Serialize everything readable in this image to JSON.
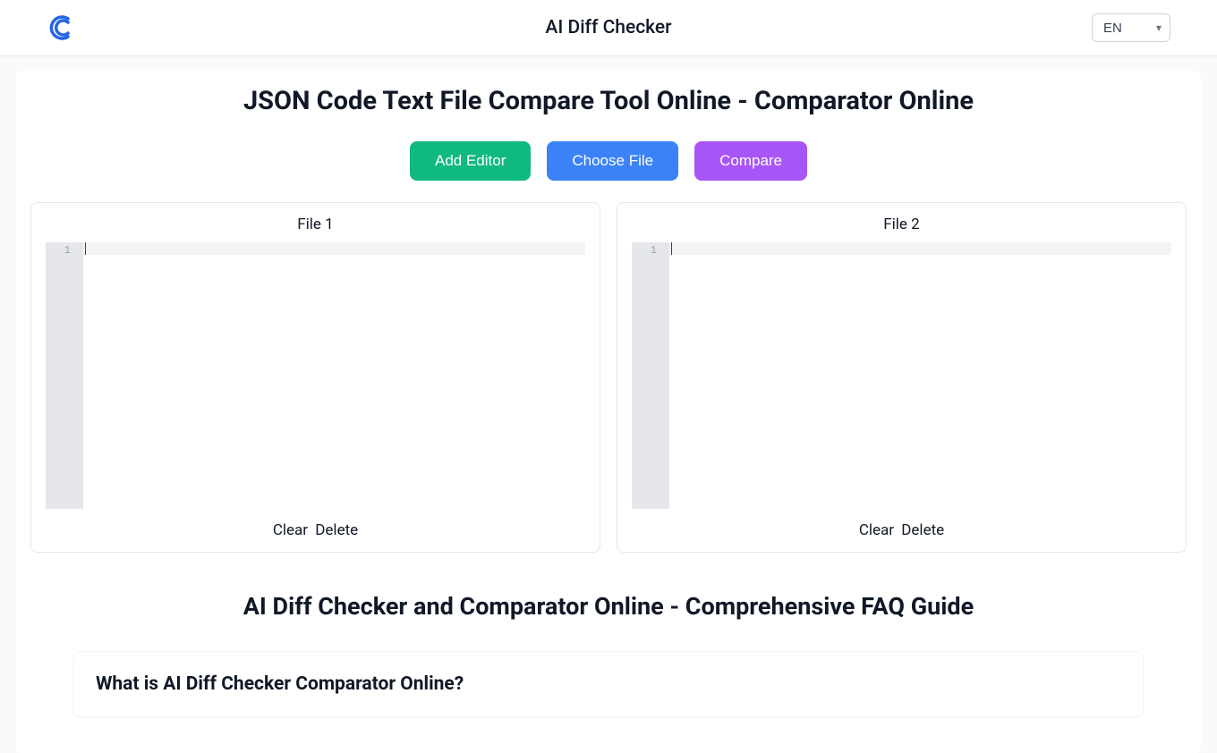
{
  "header": {
    "title": "AI Diff Checker",
    "language": {
      "selected": "EN",
      "options": [
        "EN"
      ]
    }
  },
  "main": {
    "heading": "JSON Code Text File Compare Tool Online - Comparator Online",
    "buttons": {
      "add_editor": "Add Editor",
      "choose_file": "Choose File",
      "compare": "Compare"
    },
    "editors": [
      {
        "label": "File 1",
        "gutter": "1",
        "content": "",
        "clear_label": "Clear",
        "delete_label": "Delete"
      },
      {
        "label": "File 2",
        "gutter": "1",
        "content": "",
        "clear_label": "Clear",
        "delete_label": "Delete"
      }
    ]
  },
  "faq": {
    "title": "AI Diff Checker and Comparator Online - Comprehensive FAQ Guide",
    "items": [
      {
        "question": "What is AI Diff Checker Comparator Online?"
      }
    ]
  },
  "colors": {
    "green": "#10b981",
    "blue": "#3b82f6",
    "purple": "#a855f7"
  }
}
